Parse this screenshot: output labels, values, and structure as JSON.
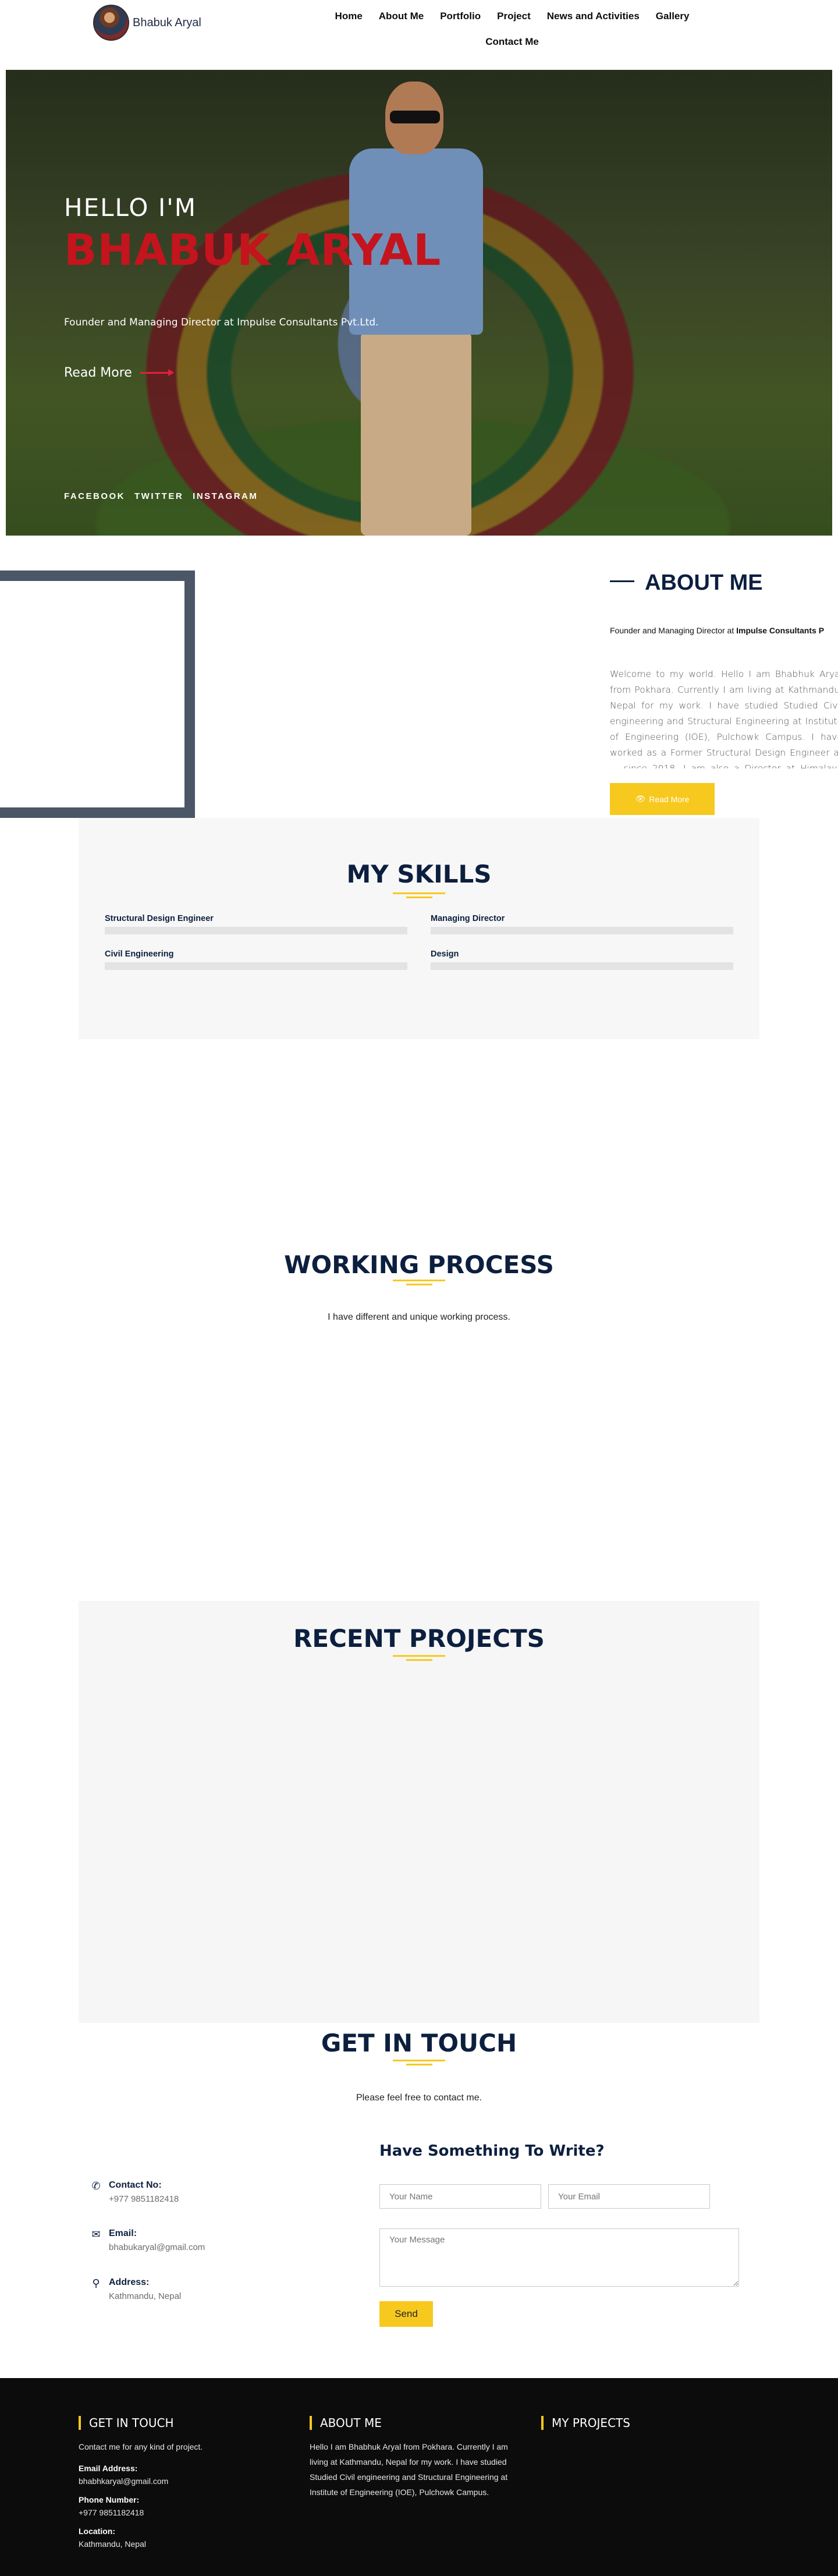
{
  "header": {
    "logo_text": "Bhabuk Aryal",
    "nav": [
      "Home",
      "About Me",
      "Portfolio",
      "Project",
      "News and Activities",
      "Gallery",
      "Contact Me"
    ]
  },
  "hero": {
    "hello": "HELLO I'M",
    "name": "BHABUK ARYAL",
    "role": "Founder and Managing Director at Impulse Consultants Pvt.Ltd.",
    "read_more": "Read More",
    "social": [
      "FACEBOOK",
      "TWITTER",
      "INSTAGRAM"
    ]
  },
  "about": {
    "title": "ABOUT ME",
    "subtitle_prefix": "Founder and Managing Director at ",
    "subtitle_bold": "Impulse Consultants P",
    "body": "Welcome to my world. Hello I am Bhabhuk Aryal from Pokhara. Currently I am living at Kathmandu, Nepal for my work. I have studied Studied Civil engineering and Structural Engineering at Institute of Engineering (IOE), Pulchowk Campus. I have worked as a Former Structural Design Engineer at ... since 2018. I am also a Director at Himalaya Geo-Solutions and founder and managing director at Impulse Consultants Pvt.Ltd.",
    "button": "Read More",
    "button_icon": "eye-icon"
  },
  "skills": {
    "title": "MY SKILLS",
    "items": [
      {
        "label": "Structural Design Engineer",
        "level": 0
      },
      {
        "label": "Managing Director",
        "level": 0
      },
      {
        "label": "Civil Engineering",
        "level": 0
      },
      {
        "label": "Design",
        "level": 0
      }
    ]
  },
  "working_process": {
    "title": "WORKING PROCESS",
    "subtitle": "I have different and unique working process."
  },
  "projects": {
    "title": "RECENT PROJECTS"
  },
  "contact": {
    "title": "GET IN TOUCH",
    "subtitle": "Please feel free to contact me.",
    "info": [
      {
        "label": "Contact No:",
        "value": "+977 9851182418",
        "icon": "phone-icon"
      },
      {
        "label": "Email:",
        "value": "bhabukaryal@gmail.com",
        "icon": "envelope-icon"
      },
      {
        "label": "Address:",
        "value": "Kathmandu, Nepal",
        "icon": "location-pin-icon"
      }
    ],
    "form_title": "Have Something To Write?",
    "name_placeholder": "Your Name",
    "email_placeholder": "Your Email",
    "message_placeholder": "Your Message",
    "send": "Send"
  },
  "footer": {
    "get_in_touch": {
      "title": "GET IN TOUCH",
      "text": "Contact me for any kind of project.",
      "email_label": "Email Address:",
      "email": "bhabhkaryal@gmail.com",
      "phone_label": "Phone Number:",
      "phone": "+977 9851182418",
      "location_label": "Location:",
      "location": "Kathmandu, Nepal"
    },
    "about": {
      "title": "ABOUT ME",
      "text": "Hello I am Bhabhuk Aryal from Pokhara. Currently I am living at Kathmandu, Nepal for my work. I have studied Studied Civil engineering and Structural Engineering at Institute of Engineering (IOE), Pulchowk Campus."
    },
    "projects": {
      "title": "MY PROJECTS"
    }
  },
  "colors": {
    "accent": "#f7c91f",
    "navy": "#0c1f3f",
    "hero_name": "#c4141d"
  }
}
